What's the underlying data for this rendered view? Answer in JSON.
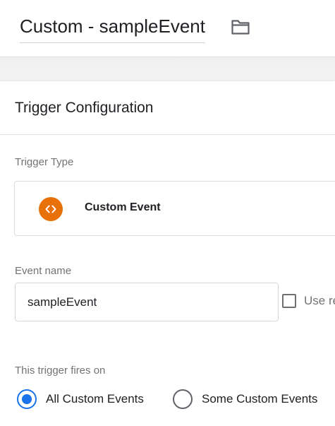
{
  "header": {
    "tag_name": "Custom - sampleEvent",
    "folder_icon": "folder-icon"
  },
  "panel": {
    "title": "Trigger Configuration"
  },
  "trigger_type": {
    "label": "Trigger Type",
    "value": "Custom Event",
    "icon": "code-brackets-icon",
    "icon_color": "#e8710a"
  },
  "event_name": {
    "label": "Event name",
    "value": "sampleEvent",
    "regex_checkbox_label": "Use re",
    "regex_checked": false
  },
  "fires_on": {
    "label": "This trigger fires on",
    "options": [
      {
        "label": "All Custom Events",
        "selected": true
      },
      {
        "label": "Some Custom Events",
        "selected": false
      }
    ],
    "accent_color": "#1a73e8"
  }
}
